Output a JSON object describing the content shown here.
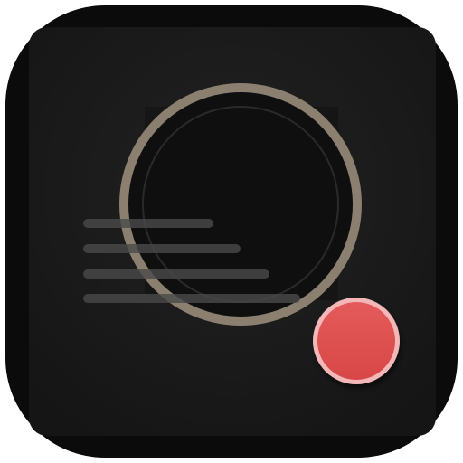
{
  "app_icon": {
    "name": "recorder-app-icon",
    "colors": {
      "tile_outer": "#0b0b0b",
      "tile_inner": "#1f1f1f",
      "lens_ring": "#8b8070",
      "lens_inner": "#101010",
      "text_lines": "#4a4a4a",
      "record_fill": "#e05050",
      "record_ring": "#f3b7b7"
    },
    "elements": {
      "lens": "camera-lens-icon",
      "document": "document-lines-icon",
      "record": "record-dot-icon"
    }
  }
}
